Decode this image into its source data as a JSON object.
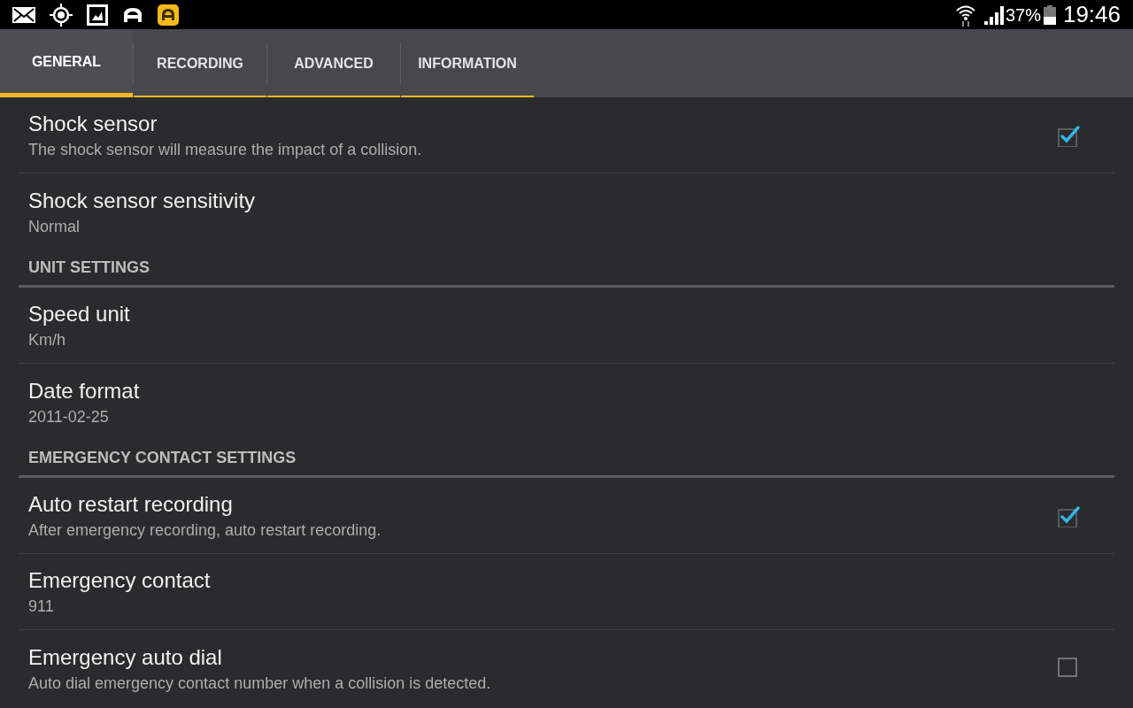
{
  "status_bar": {
    "battery_percent": "37%",
    "time": "19:46"
  },
  "tabs": [
    {
      "label": "GENERAL",
      "selected": true
    },
    {
      "label": "RECORDING",
      "selected": false
    },
    {
      "label": "ADVANCED",
      "selected": false
    },
    {
      "label": "INFORMATION",
      "selected": false
    }
  ],
  "items": [
    {
      "kind": "preference",
      "title": "Shock sensor",
      "summary": "The shock sensor will measure the impact of a collision.",
      "checked": true
    },
    {
      "kind": "preference",
      "title": "Shock sensor sensitivity",
      "summary": "Normal"
    },
    {
      "kind": "header",
      "title": "UNIT SETTINGS"
    },
    {
      "kind": "preference",
      "title": "Speed unit",
      "summary": "Km/h"
    },
    {
      "kind": "preference",
      "title": "Date format",
      "summary": "2011-02-25"
    },
    {
      "kind": "header",
      "title": "EMERGENCY CONTACT SETTINGS"
    },
    {
      "kind": "preference",
      "title": "Auto restart recording",
      "summary": "After emergency recording, auto restart recording.",
      "checked": true
    },
    {
      "kind": "preference",
      "title": "Emergency contact",
      "summary": "911"
    },
    {
      "kind": "preference",
      "title": "Emergency auto dial",
      "summary": "Auto dial emergency contact number when a collision is detected.",
      "checked": false
    }
  ]
}
